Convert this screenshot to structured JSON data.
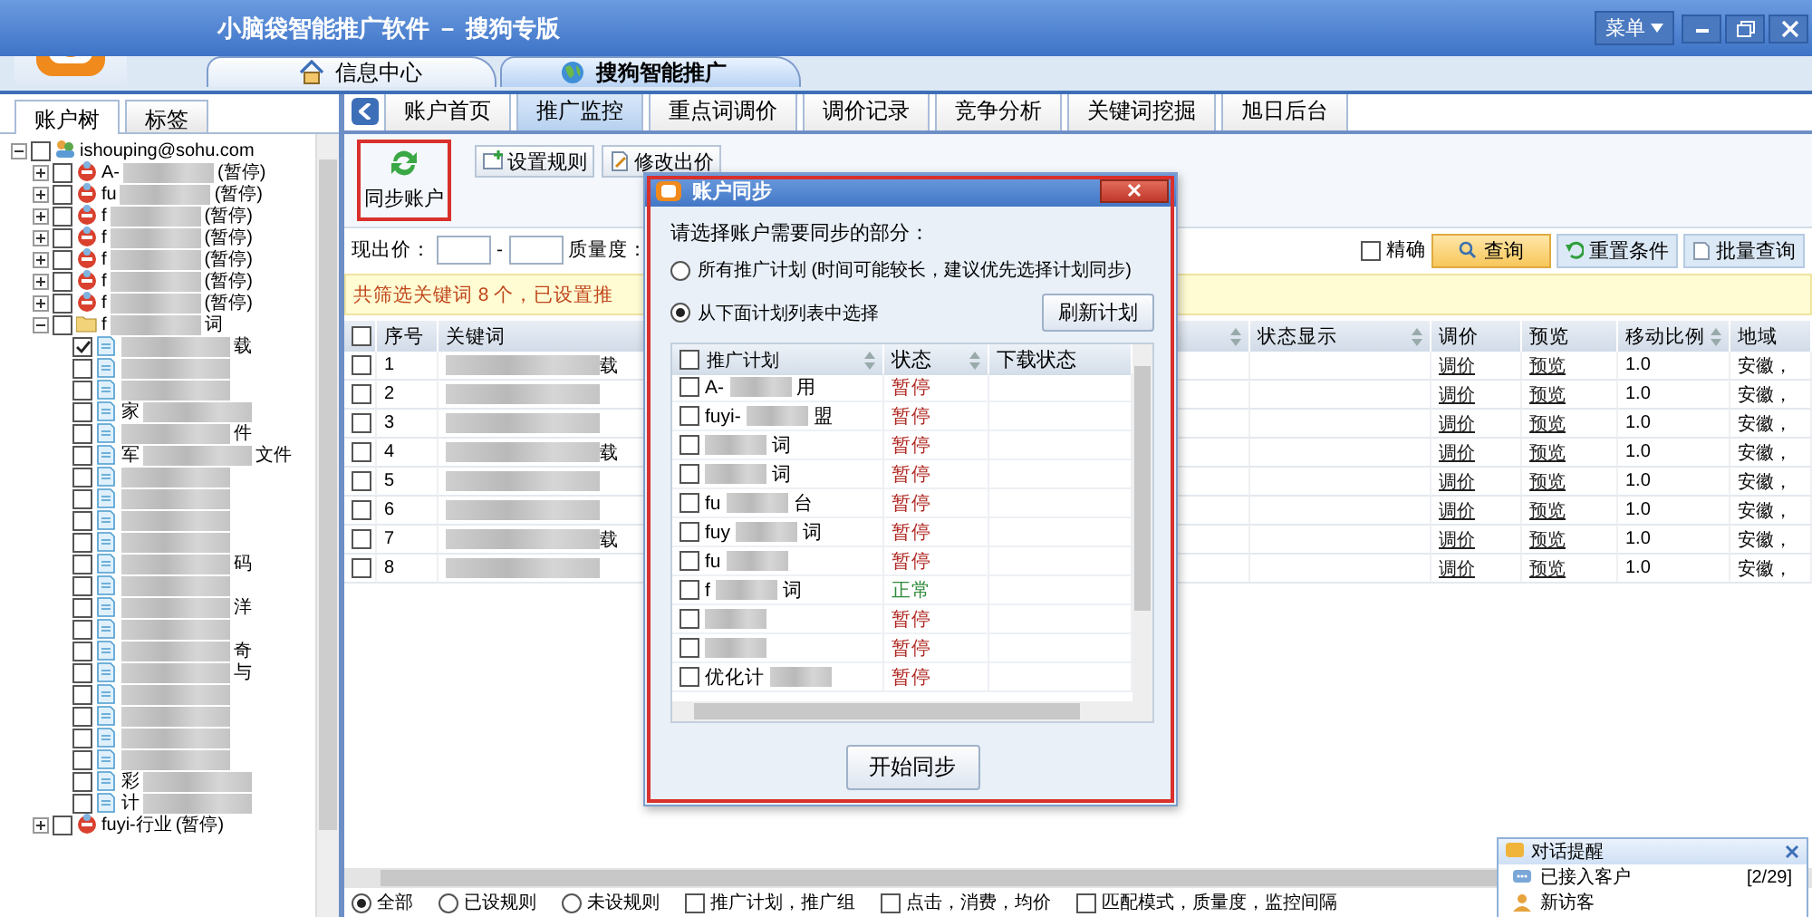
{
  "window": {
    "title": "小脑袋智能推广软件 － 搜狗专版",
    "menu": "菜单"
  },
  "app_tabs": [
    {
      "label": "信息中心",
      "kind": "home",
      "selected": false
    },
    {
      "label": "搜狗智能推广",
      "kind": "globe",
      "selected": true
    }
  ],
  "sidebar": {
    "tabs": [
      {
        "label": "账户树",
        "selected": true
      },
      {
        "label": "标签",
        "selected": false
      }
    ],
    "tree": {
      "label": "ishouping@sohu.com",
      "kind": "account",
      "checked": false,
      "expanded": true,
      "children": [
        {
          "prefix": "A-",
          "suffix": "(暂停)",
          "kind": "plan",
          "checked": false,
          "expanded": false,
          "blurred": true
        },
        {
          "prefix": "fu",
          "suffix": "(暂停)",
          "kind": "plan",
          "checked": false,
          "expanded": false,
          "blurred": true
        },
        {
          "prefix": "f",
          "suffix": "(暂停)",
          "kind": "plan",
          "checked": false,
          "expanded": false,
          "blurred": true
        },
        {
          "prefix": "f",
          "suffix": "(暂停)",
          "kind": "plan",
          "checked": false,
          "expanded": false,
          "blurred": true
        },
        {
          "prefix": "f",
          "suffix": "(暂停)",
          "kind": "plan",
          "checked": false,
          "expanded": false,
          "blurred": true
        },
        {
          "prefix": "f",
          "suffix": "(暂停)",
          "kind": "plan",
          "checked": false,
          "expanded": false,
          "blurred": true
        },
        {
          "prefix": "f",
          "suffix": "(暂停)",
          "kind": "plan",
          "checked": false,
          "expanded": false,
          "blurred": true
        },
        {
          "prefix": "f",
          "suffix": "词",
          "kind": "folder",
          "checked": false,
          "expanded": true,
          "blurred": true,
          "children": [
            {
              "suffix": "载",
              "kind": "keyword",
              "checked": true,
              "blurred": true
            },
            {
              "kind": "keyword",
              "checked": false,
              "blurred": true
            },
            {
              "kind": "keyword",
              "checked": false,
              "blurred": true
            },
            {
              "prefix": "家",
              "kind": "keyword",
              "checked": false,
              "blurred": true
            },
            {
              "suffix": "件",
              "kind": "keyword",
              "checked": false,
              "blurred": true
            },
            {
              "prefix": "军",
              "suffix": "文件",
              "kind": "keyword",
              "checked": false,
              "blurred": true
            },
            {
              "kind": "keyword",
              "checked": false,
              "blurred": true
            },
            {
              "kind": "keyword",
              "checked": false,
              "blurred": true
            },
            {
              "kind": "keyword",
              "checked": false,
              "blurred": true
            },
            {
              "kind": "keyword",
              "checked": false,
              "blurred": true
            },
            {
              "suffix": "码",
              "kind": "keyword",
              "checked": false,
              "blurred": true
            },
            {
              "kind": "keyword",
              "checked": false,
              "blurred": true
            },
            {
              "suffix": "洋",
              "kind": "keyword",
              "checked": false,
              "blurred": true
            },
            {
              "kind": "keyword",
              "checked": false,
              "blurred": true
            },
            {
              "suffix": "奇",
              "kind": "keyword",
              "checked": false,
              "blurred": true
            },
            {
              "suffix": "与",
              "kind": "keyword",
              "checked": false,
              "blurred": true
            },
            {
              "kind": "keyword",
              "checked": false,
              "blurred": true
            },
            {
              "kind": "keyword",
              "checked": false,
              "blurred": true
            },
            {
              "kind": "keyword",
              "checked": false,
              "blurred": true
            },
            {
              "kind": "keyword",
              "checked": false,
              "blurred": true
            },
            {
              "prefix": "彩",
              "kind": "keyword",
              "checked": false,
              "blurred": true
            },
            {
              "prefix": "计",
              "kind": "keyword",
              "checked": false,
              "blurred": true
            }
          ]
        },
        {
          "prefix": "fuyi-行业",
          "suffix": "(暂停)",
          "kind": "plan",
          "checked": false,
          "expanded": false,
          "blurred": false
        }
      ]
    }
  },
  "main": {
    "tabs": [
      {
        "label": "账户首页",
        "selected": false
      },
      {
        "label": "推广监控",
        "selected": true
      },
      {
        "label": "重点词调价",
        "selected": false
      },
      {
        "label": "调价记录",
        "selected": false
      },
      {
        "label": "竞争分析",
        "selected": false
      },
      {
        "label": "关键词挖掘",
        "selected": false
      },
      {
        "label": "旭日后台",
        "selected": false
      }
    ],
    "toolbar": {
      "sync_button": {
        "label": "同步账户",
        "highlighted": true
      },
      "buttons": [
        {
          "label": "设置规则",
          "kind": "add"
        },
        {
          "label": "修改出价",
          "kind": "edit"
        }
      ]
    },
    "filters": {
      "price_label": "现出价：",
      "price_separator": "-",
      "quality_label": "质量度：",
      "exact_label": "精确",
      "exact_checked": false,
      "query_button": "查询",
      "reset_button": "重置条件",
      "batch_button": "批量查询"
    },
    "banner": "共筛选关键词 8 个，已设置推",
    "table": {
      "header_checked": false,
      "columns": [
        "序号",
        "关键词",
        "状态显示",
        "调价",
        "预览",
        "移动比例",
        "地域"
      ],
      "rows": [
        {
          "index": "1",
          "keyword_suffix": "载",
          "adjust": "调价",
          "preview": "预览",
          "mobile_ratio": "1.0",
          "region": "安徽，",
          "checked": false
        },
        {
          "index": "2",
          "adjust": "调价",
          "preview": "预览",
          "mobile_ratio": "1.0",
          "region": "安徽，",
          "checked": false
        },
        {
          "index": "3",
          "adjust": "调价",
          "preview": "预览",
          "mobile_ratio": "1.0",
          "region": "安徽，",
          "checked": false
        },
        {
          "index": "4",
          "keyword_suffix": "载",
          "adjust": "调价",
          "preview": "预览",
          "mobile_ratio": "1.0",
          "region": "安徽，",
          "checked": false
        },
        {
          "index": "5",
          "adjust": "调价",
          "preview": "预览",
          "mobile_ratio": "1.0",
          "region": "安徽，",
          "checked": false
        },
        {
          "index": "6",
          "adjust": "调价",
          "preview": "预览",
          "mobile_ratio": "1.0",
          "region": "安徽，",
          "checked": false
        },
        {
          "index": "7",
          "keyword_suffix": "载",
          "adjust": "调价",
          "preview": "预览",
          "mobile_ratio": "1.0",
          "region": "安徽，",
          "checked": false
        },
        {
          "index": "8",
          "adjust": "调价",
          "preview": "预览",
          "mobile_ratio": "1.0",
          "region": "安徽，",
          "checked": false
        }
      ]
    },
    "bottom_options": [
      {
        "label": "全部",
        "kind": "radio",
        "selected": true
      },
      {
        "label": "已设规则",
        "kind": "radio",
        "selected": false
      },
      {
        "label": "未设规则",
        "kind": "radio",
        "selected": false
      },
      {
        "label": "推广计划，推广组",
        "kind": "checkbox",
        "selected": false
      },
      {
        "label": "点击，消费，均价",
        "kind": "checkbox",
        "selected": false
      },
      {
        "label": "匹配模式，质量度，监控间隔",
        "kind": "checkbox",
        "selected": false
      }
    ]
  },
  "dialog": {
    "title": "账户同步",
    "highlighted": true,
    "prompt": "请选择账户需要同步的部分：",
    "options": [
      {
        "label": "所有推广计划 (时间可能较长，建议优先选择计划同步)",
        "selected": false
      },
      {
        "label": "从下面计划列表中选择",
        "selected": true
      }
    ],
    "refresh_button": "刷新计划",
    "header_checked": false,
    "columns": [
      "推广计划",
      "状态",
      "下载状态"
    ],
    "plans": [
      {
        "prefix": "A-",
        "suffix": "用",
        "status": "暂停",
        "active": false,
        "checked": false
      },
      {
        "prefix": "fuyi-",
        "suffix": "盟",
        "status": "暂停",
        "active": false,
        "checked": false
      },
      {
        "suffix": "词",
        "status": "暂停",
        "active": false,
        "checked": false
      },
      {
        "suffix": "词",
        "status": "暂停",
        "active": false,
        "checked": false
      },
      {
        "prefix": "fu",
        "suffix": "台",
        "status": "暂停",
        "active": false,
        "checked": false
      },
      {
        "prefix": "fuy",
        "suffix": "词",
        "status": "暂停",
        "active": false,
        "checked": false
      },
      {
        "prefix": "fu",
        "status": "暂停",
        "active": false,
        "checked": false
      },
      {
        "prefix": "f",
        "suffix": "词",
        "status": "正常",
        "active": true,
        "checked": false
      },
      {
        "status": "暂停",
        "active": false,
        "checked": false
      },
      {
        "status": "暂停",
        "active": false,
        "checked": false
      },
      {
        "prefix": "优化计",
        "status": "暂停",
        "active": false,
        "checked": false
      }
    ],
    "start_button": "开始同步"
  },
  "notification": {
    "title": "对话提醒",
    "items": [
      {
        "label": "已接入客户",
        "count": "[2/29]",
        "kind": "chat"
      },
      {
        "label": "新访客",
        "kind": "visitor"
      }
    ]
  }
}
